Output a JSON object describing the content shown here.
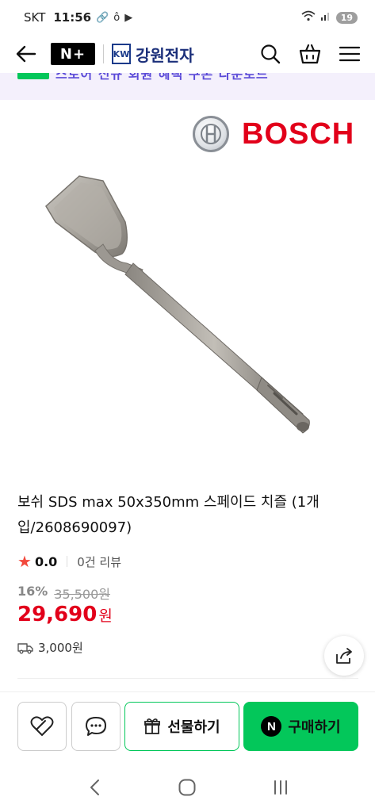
{
  "status": {
    "carrier": "SKT",
    "time": "11:56",
    "battery": "19"
  },
  "header": {
    "logo": "N+",
    "store_name": "강원전자",
    "store_mark": "KW"
  },
  "promo": {
    "text": "스토어 신규 회원 혜택 쿠폰 다운로드"
  },
  "brand": {
    "name": "BOSCH"
  },
  "product": {
    "title": "보쉬 SDS max 50x350mm 스페이드 치즐 (1개입/2608690097)",
    "rating": "0.0",
    "review_count": "0건 리뷰",
    "discount": "16%",
    "original_price": "35,500원",
    "sale_price": "29,690",
    "currency": "원",
    "shipping": "3,000원"
  },
  "actions": {
    "gift_label": "선물하기",
    "buy_label": "구매하기",
    "buy_badge": "N"
  },
  "colors": {
    "accent_green": "#03c75a",
    "price_red": "#e2001a",
    "brand_red": "#e2001a"
  }
}
